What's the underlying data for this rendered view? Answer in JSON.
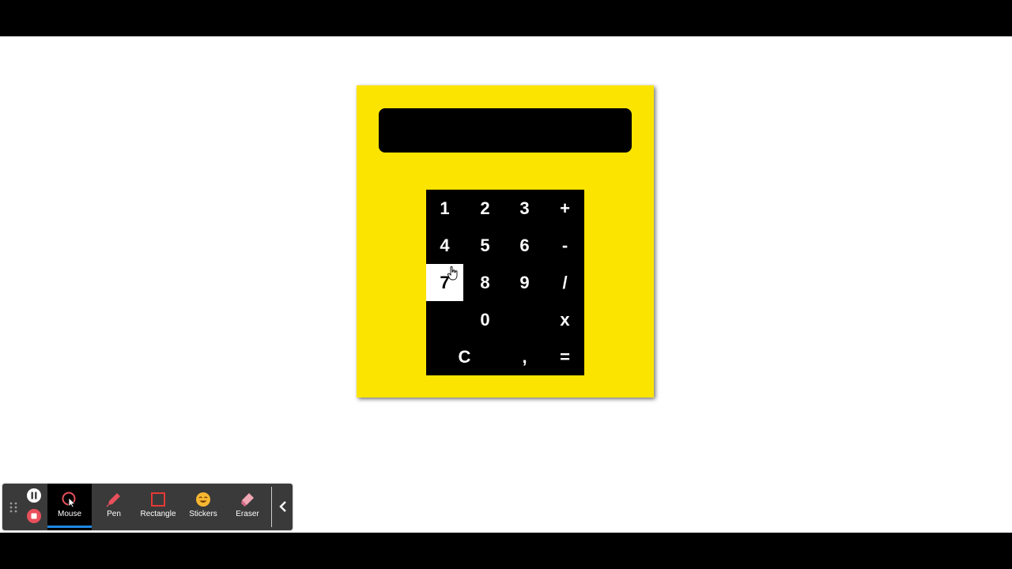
{
  "calculator": {
    "display_value": "",
    "keys": [
      {
        "label": "1",
        "name": "key-1"
      },
      {
        "label": "2",
        "name": "key-2"
      },
      {
        "label": "3",
        "name": "key-3"
      },
      {
        "label": "+",
        "name": "key-plus"
      },
      {
        "label": "4",
        "name": "key-4"
      },
      {
        "label": "5",
        "name": "key-5"
      },
      {
        "label": "6",
        "name": "key-6"
      },
      {
        "label": "-",
        "name": "key-minus"
      },
      {
        "label": "7",
        "name": "key-7"
      },
      {
        "label": "8",
        "name": "key-8"
      },
      {
        "label": "9",
        "name": "key-9"
      },
      {
        "label": "/",
        "name": "key-divide"
      },
      {
        "label": "0",
        "name": "key-0"
      },
      {
        "label": "x",
        "name": "key-multiply"
      },
      {
        "label": "C",
        "name": "key-clear"
      },
      {
        "label": ",",
        "name": "key-comma"
      },
      {
        "label": "=",
        "name": "key-equals"
      }
    ],
    "hovered_key": "7",
    "colors": {
      "body": "#fbe400",
      "keypad": "#000000",
      "key_text": "#ffffff"
    }
  },
  "toolbar": {
    "controls": [
      "pause-icon",
      "stop-icon"
    ],
    "tools": [
      {
        "label": "Mouse",
        "icon": "mouse-cursor-icon",
        "active": true
      },
      {
        "label": "Pen",
        "icon": "pen-icon",
        "active": false
      },
      {
        "label": "Rectangle",
        "icon": "rectangle-icon",
        "active": false
      },
      {
        "label": "Stickers",
        "icon": "smiley-sticker-icon",
        "active": false
      },
      {
        "label": "Eraser",
        "icon": "eraser-icon",
        "active": false
      }
    ],
    "collapse_icon": "chevron-left-icon",
    "accent": "#1e88e5"
  }
}
